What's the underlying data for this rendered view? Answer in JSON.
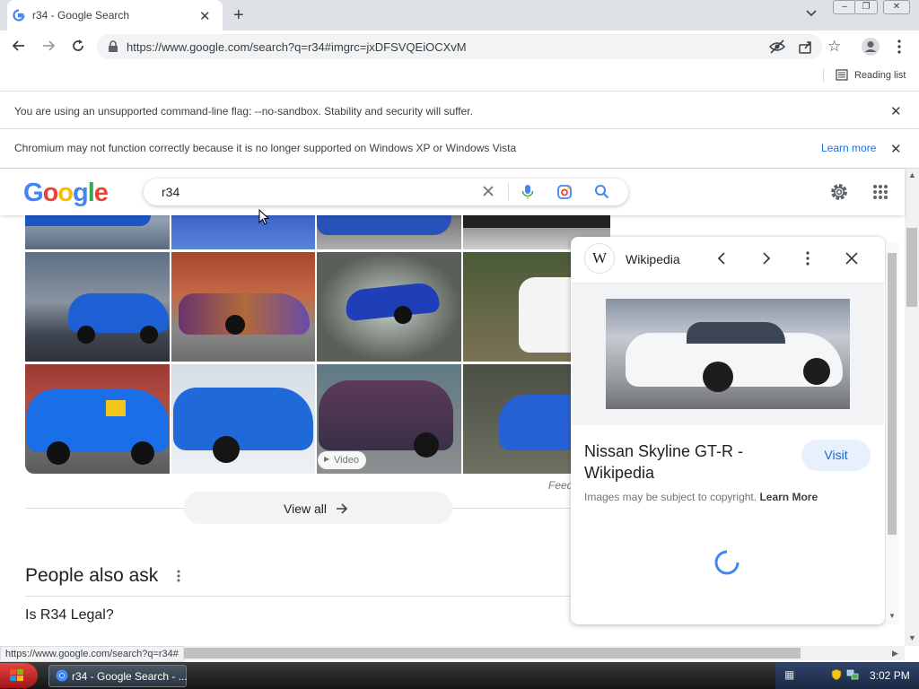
{
  "browser": {
    "tab_title": "r34 - Google Search",
    "url": "https://www.google.com/search?q=r34#imgrc=jxDFSVQEiOCXvM",
    "reading_list_label": "Reading list",
    "status_url": "https://www.google.com/search?q=r34#"
  },
  "infobars": {
    "sandbox_warning": "You are using an unsupported command-line flag: --no-sandbox. Stability and security will suffer.",
    "xp_warning": "Chromium may not function correctly because it is no longer supported on Windows XP or Windows Vista",
    "learn_more": "Learn more"
  },
  "google": {
    "logo_text": "Google",
    "query": "r34",
    "video_badge": "Video",
    "feedback": "Feedback",
    "view_all": "View all",
    "people_also_ask": "People also ask",
    "questions": [
      "Is R34 Legal?"
    ]
  },
  "panel": {
    "source": "Wikipedia",
    "wiki_glyph": "W",
    "title": "Nissan Skyline GT-R - Wikipedia",
    "visit": "Visit",
    "copyright": "Images may be subject to copyright.",
    "copyright_link": "Learn More"
  },
  "taskbar": {
    "window_label": "r34 - Google Search - ...",
    "clock": "3:02 PM"
  },
  "colors": {
    "accent": "#1a73e8",
    "visit_bg": "#e8f0fe"
  }
}
